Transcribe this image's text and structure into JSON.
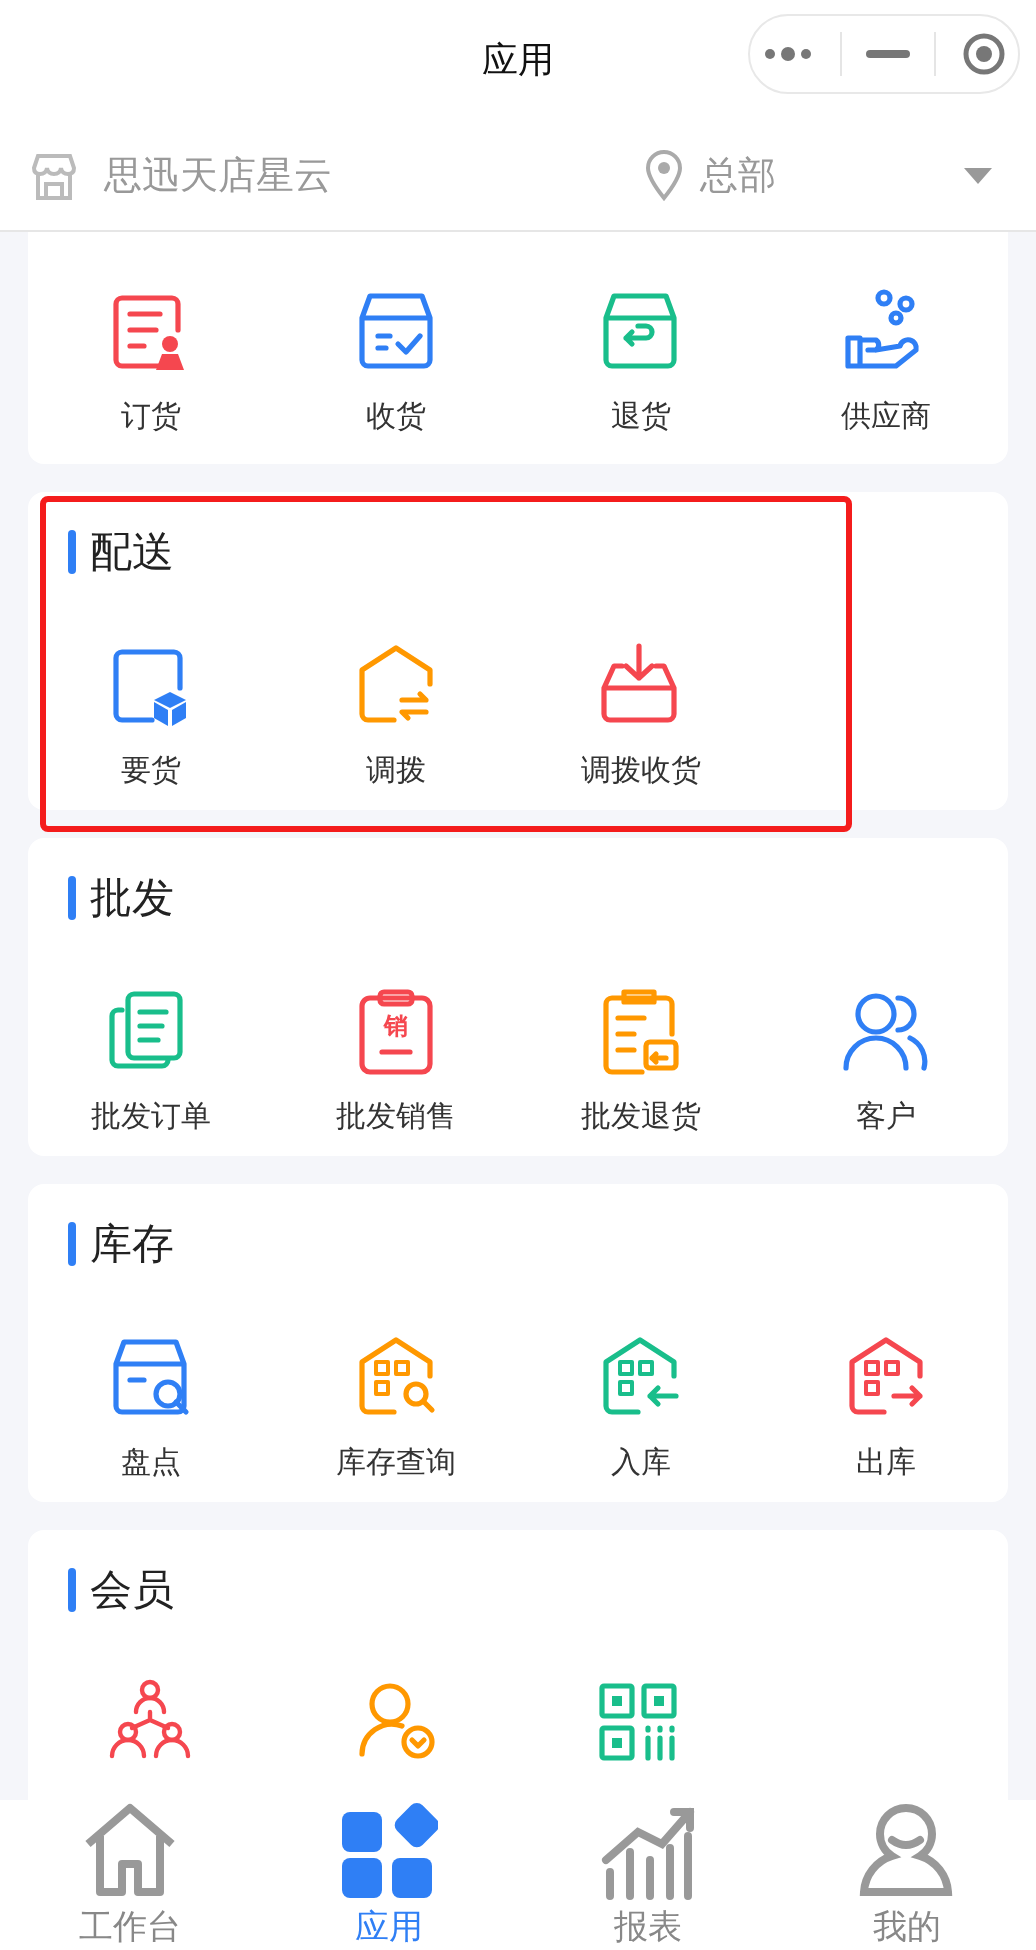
{
  "header": {
    "title": "应用"
  },
  "store_bar": {
    "store": "思迅天店星云",
    "location": "总部"
  },
  "sections": [
    {
      "highlighted": false,
      "items": [
        {
          "kind": "shortcut",
          "label": "订货"
        },
        {
          "kind": "shortcut",
          "label": "收货"
        },
        {
          "kind": "shortcut",
          "label": "退货"
        },
        {
          "kind": "shortcut",
          "label": "供应商"
        }
      ]
    },
    {
      "title": "配送",
      "highlighted": true,
      "items": [
        {
          "kind": "shortcut",
          "label": "要货"
        },
        {
          "kind": "shortcut",
          "label": "调拨"
        },
        {
          "kind": "shortcut",
          "label": "调拨收货"
        }
      ]
    },
    {
      "title": "批发",
      "highlighted": false,
      "items": [
        {
          "kind": "shortcut",
          "label": "批发订单"
        },
        {
          "kind": "shortcut",
          "label": "批发销售",
          "icon_text": "销"
        },
        {
          "kind": "shortcut",
          "label": "批发退货"
        },
        {
          "kind": "shortcut",
          "label": "客户"
        }
      ]
    },
    {
      "title": "库存",
      "highlighted": false,
      "items": [
        {
          "kind": "shortcut",
          "label": "盘点"
        },
        {
          "kind": "shortcut",
          "label": "库存查询"
        },
        {
          "kind": "shortcut",
          "label": "入库"
        },
        {
          "kind": "shortcut",
          "label": "出库"
        }
      ]
    },
    {
      "title": "会员",
      "highlighted": false,
      "items": [
        {
          "kind": "shortcut"
        },
        {
          "kind": "shortcut"
        },
        {
          "kind": "shortcut"
        }
      ]
    }
  ],
  "tab_bar": [
    {
      "label": "工作台",
      "selected": false
    },
    {
      "label": "应用",
      "selected": true
    },
    {
      "label": "报表",
      "selected": false
    },
    {
      "label": "我的",
      "selected": false
    }
  ]
}
